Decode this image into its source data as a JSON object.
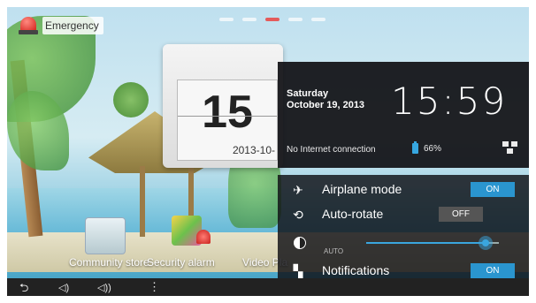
{
  "emergency": {
    "label": "Emergency"
  },
  "clock_widget": {
    "day_number": "15",
    "date_short": "2013-10-"
  },
  "quick_settings": {
    "weekday": "Saturday",
    "date": "October 19, 2013",
    "time": "15:59",
    "network_status": "No Internet connection",
    "battery": "66%",
    "rows": {
      "airplane": {
        "label": "Airplane mode",
        "state": "ON"
      },
      "autorotate": {
        "label": "Auto-rotate",
        "state": "OFF"
      },
      "brightness": {
        "auto_label": "AUTO",
        "level": 0.9
      },
      "notifications": {
        "label": "Notifications",
        "state": "ON"
      }
    }
  },
  "dock": {
    "apps": [
      "Community store",
      "Security alarm",
      "Video Pla"
    ]
  },
  "colors": {
    "accent": "#2a95cf",
    "panel": "#0f0f14",
    "emergency_red": "#d3201a"
  },
  "icons": {
    "back": "back-icon",
    "volume_down": "volume-down-icon",
    "volume_up": "volume-up-icon",
    "menu": "menu-icon"
  }
}
